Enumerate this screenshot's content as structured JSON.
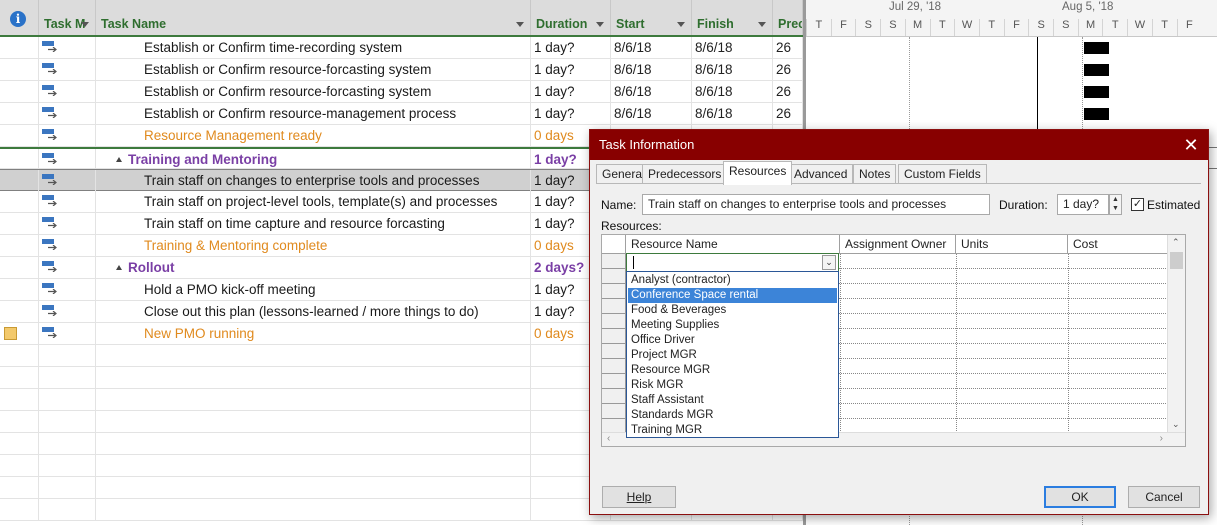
{
  "grid": {
    "headers": {
      "task_mode": "Task M",
      "task_name": "Task Name",
      "duration": "Duration",
      "start": "Start",
      "finish": "Finish",
      "predecessors": "Prec"
    },
    "rows": [
      {
        "name": "Establish or Confirm time-recording system",
        "duration": "1 day?",
        "start": "8/6/18",
        "finish": "8/6/18",
        "pred": "26",
        "kind": "task"
      },
      {
        "name": "Establish or Confirm resource-forcasting system",
        "duration": "1 day?",
        "start": "8/6/18",
        "finish": "8/6/18",
        "pred": "26",
        "kind": "task"
      },
      {
        "name": "Establish or Confirm resource-forcasting system",
        "duration": "1 day?",
        "start": "8/6/18",
        "finish": "8/6/18",
        "pred": "26",
        "kind": "task"
      },
      {
        "name": "Establish or Confirm resource-management process",
        "duration": "1 day?",
        "start": "8/6/18",
        "finish": "8/6/18",
        "pred": "26",
        "kind": "task"
      },
      {
        "name": "Resource Management ready",
        "duration": "0 days",
        "start": "",
        "finish": "",
        "pred": "",
        "kind": "milestone"
      },
      {
        "name": "Training and Mentoring",
        "duration": "1 day?",
        "start": "",
        "finish": "",
        "pred": "",
        "kind": "summary"
      },
      {
        "name": "Train staff on changes to enterprise tools and processes",
        "duration": "1 day?",
        "start": "",
        "finish": "",
        "pred": "",
        "kind": "task",
        "selected": true
      },
      {
        "name": "Train staff on project-level tools, template(s) and processes",
        "duration": "1 day?",
        "start": "",
        "finish": "",
        "pred": "",
        "kind": "task"
      },
      {
        "name": "Train staff on time capture and resource forcasting",
        "duration": "1 day?",
        "start": "",
        "finish": "",
        "pred": "",
        "kind": "task"
      },
      {
        "name": "Training & Mentoring complete",
        "duration": "0 days",
        "start": "",
        "finish": "",
        "pred": "",
        "kind": "milestone"
      },
      {
        "name": "Rollout",
        "duration": "2 days?",
        "start": "",
        "finish": "",
        "pred": "",
        "kind": "summary"
      },
      {
        "name": "Hold a PMO kick-off meeting",
        "duration": "1 day?",
        "start": "",
        "finish": "",
        "pred": "",
        "kind": "task"
      },
      {
        "name": "Close out this plan (lessons-learned / more things to do)",
        "duration": "1 day?",
        "start": "",
        "finish": "",
        "pred": "",
        "kind": "task"
      },
      {
        "name": "New PMO running",
        "duration": "0 days",
        "start": "",
        "finish": "",
        "pred": "",
        "kind": "milestone",
        "note": true
      }
    ]
  },
  "gantt": {
    "weeks": [
      "Jul 29, '18",
      "Aug 5, '18"
    ],
    "days": [
      "T",
      "F",
      "S",
      "S",
      "M",
      "T",
      "W",
      "T",
      "F",
      "S",
      "S",
      "M",
      "T",
      "W",
      "T",
      "F"
    ]
  },
  "dialog": {
    "title": "Task Information",
    "tabs": [
      "General",
      "Predecessors",
      "Resources",
      "Advanced",
      "Notes",
      "Custom Fields"
    ],
    "name_label": "Name:",
    "name_value": "Train staff on changes to enterprise tools and processes",
    "duration_label": "Duration:",
    "duration_value": "1 day?",
    "estimated_label": "Estimated",
    "resources_label": "Resources:",
    "columns": [
      "Resource Name",
      "Assignment Owner",
      "Units",
      "Cost"
    ],
    "dropdown_items": [
      "Analyst (contractor)",
      "Conference Space rental",
      "Food & Beverages",
      "Meeting Supplies",
      "Office Driver",
      "Project MGR",
      "Resource MGR",
      "Risk MGR",
      "Staff Assistant",
      "Standards MGR",
      "Training MGR"
    ],
    "help_label": "Help",
    "ok_label": "OK",
    "cancel_label": "Cancel"
  },
  "colors": {
    "title_bar": "#880000",
    "header_text": "#2f6e2f",
    "milestone_text": "#e08a1e",
    "summary_text": "#7a3fa5",
    "highlight": "#3c84d8"
  }
}
